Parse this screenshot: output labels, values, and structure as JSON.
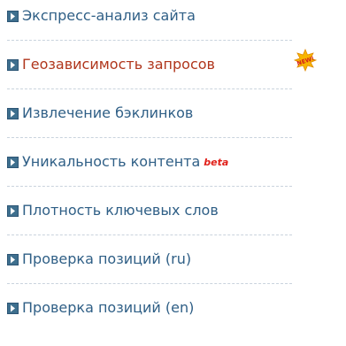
{
  "menu": {
    "items": [
      {
        "label": "Экспресс-анализ сайта"
      },
      {
        "label": "Геозависимость запросов",
        "badge": "NEW!"
      },
      {
        "label": "Извлечение бэклинков"
      },
      {
        "label": "Уникальность контента",
        "badge": "beta"
      },
      {
        "label": "Плотность ключевых слов"
      },
      {
        "label": "Проверка позиций (ru)"
      },
      {
        "label": "Проверка позиций (en)"
      }
    ]
  },
  "icons": {
    "bullet": "chevron-right-box-icon",
    "new": "new-star-badge-icon"
  },
  "colors": {
    "link": "#2f5f86",
    "active_link": "#b0361c",
    "bullet": "#3e6f8e",
    "beta": "#e0201a",
    "divider": "#c9d3dd"
  }
}
